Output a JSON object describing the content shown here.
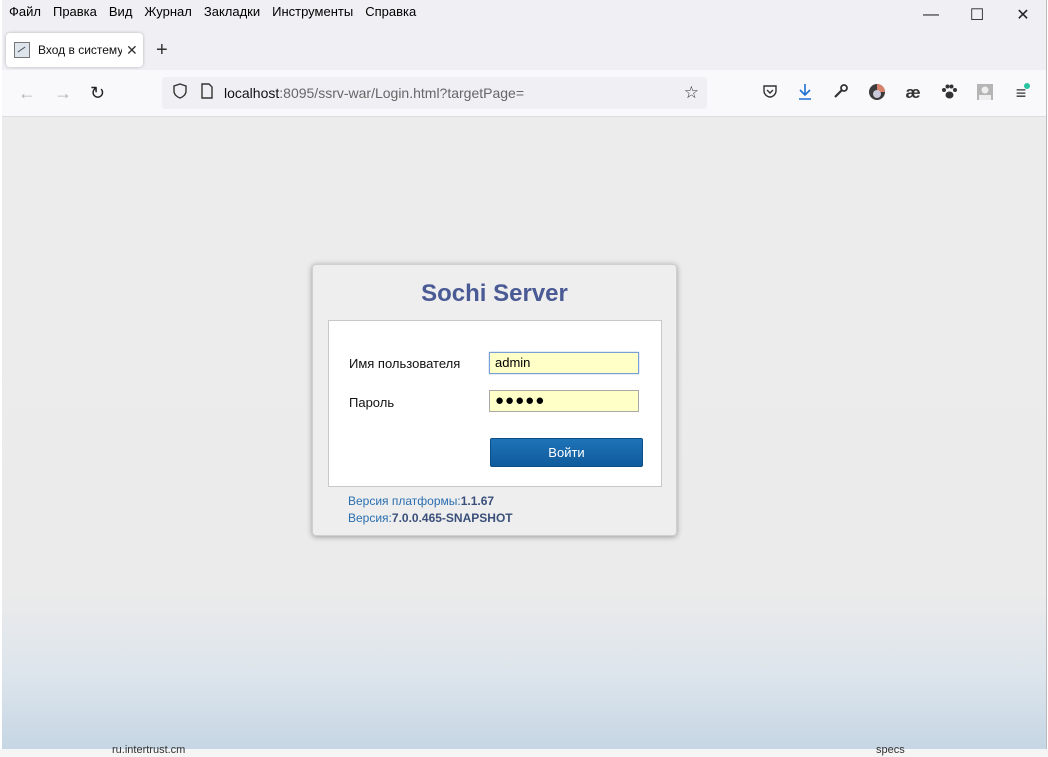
{
  "menu": [
    "Файл",
    "Правка",
    "Вид",
    "Журнал",
    "Закладки",
    "Инструменты",
    "Справка"
  ],
  "window_controls": {
    "minimize": "—",
    "maximize": "☐",
    "close": "✕"
  },
  "tab": {
    "title": "Вход в систему",
    "close": "✕",
    "new_tab": "+"
  },
  "nav": {
    "back": "←",
    "forward": "→",
    "reload": "↻"
  },
  "url": {
    "host": "localhost",
    "rest": ":8095/ssrv-war/Login.html?targetPage="
  },
  "toolbar_icons": [
    "pocket-icon",
    "download-icon",
    "wrench-icon",
    "profile-icon",
    "ae-extension-icon",
    "paw-icon",
    "account-icon",
    "menu-icon"
  ],
  "login": {
    "app_title": "Sochi Server",
    "username_label": "Имя пользователя",
    "username_value": "admin",
    "password_label": "Пароль",
    "password_value": "●●●●●",
    "submit_label": "Войти",
    "platform_version_label": "Версия платформы:",
    "platform_version_value": "1.1.67",
    "version_label": "Версия:",
    "version_value": "7.0.0.465-SNAPSHOT"
  },
  "background_peek": {
    "left_text": "ru.intertrust.cm",
    "right_text": "specs"
  },
  "colors": {
    "title": "#4a5a94",
    "button": "#1666aa",
    "input_bg": "#ffffc8",
    "version_text": "#2a6fb0"
  }
}
